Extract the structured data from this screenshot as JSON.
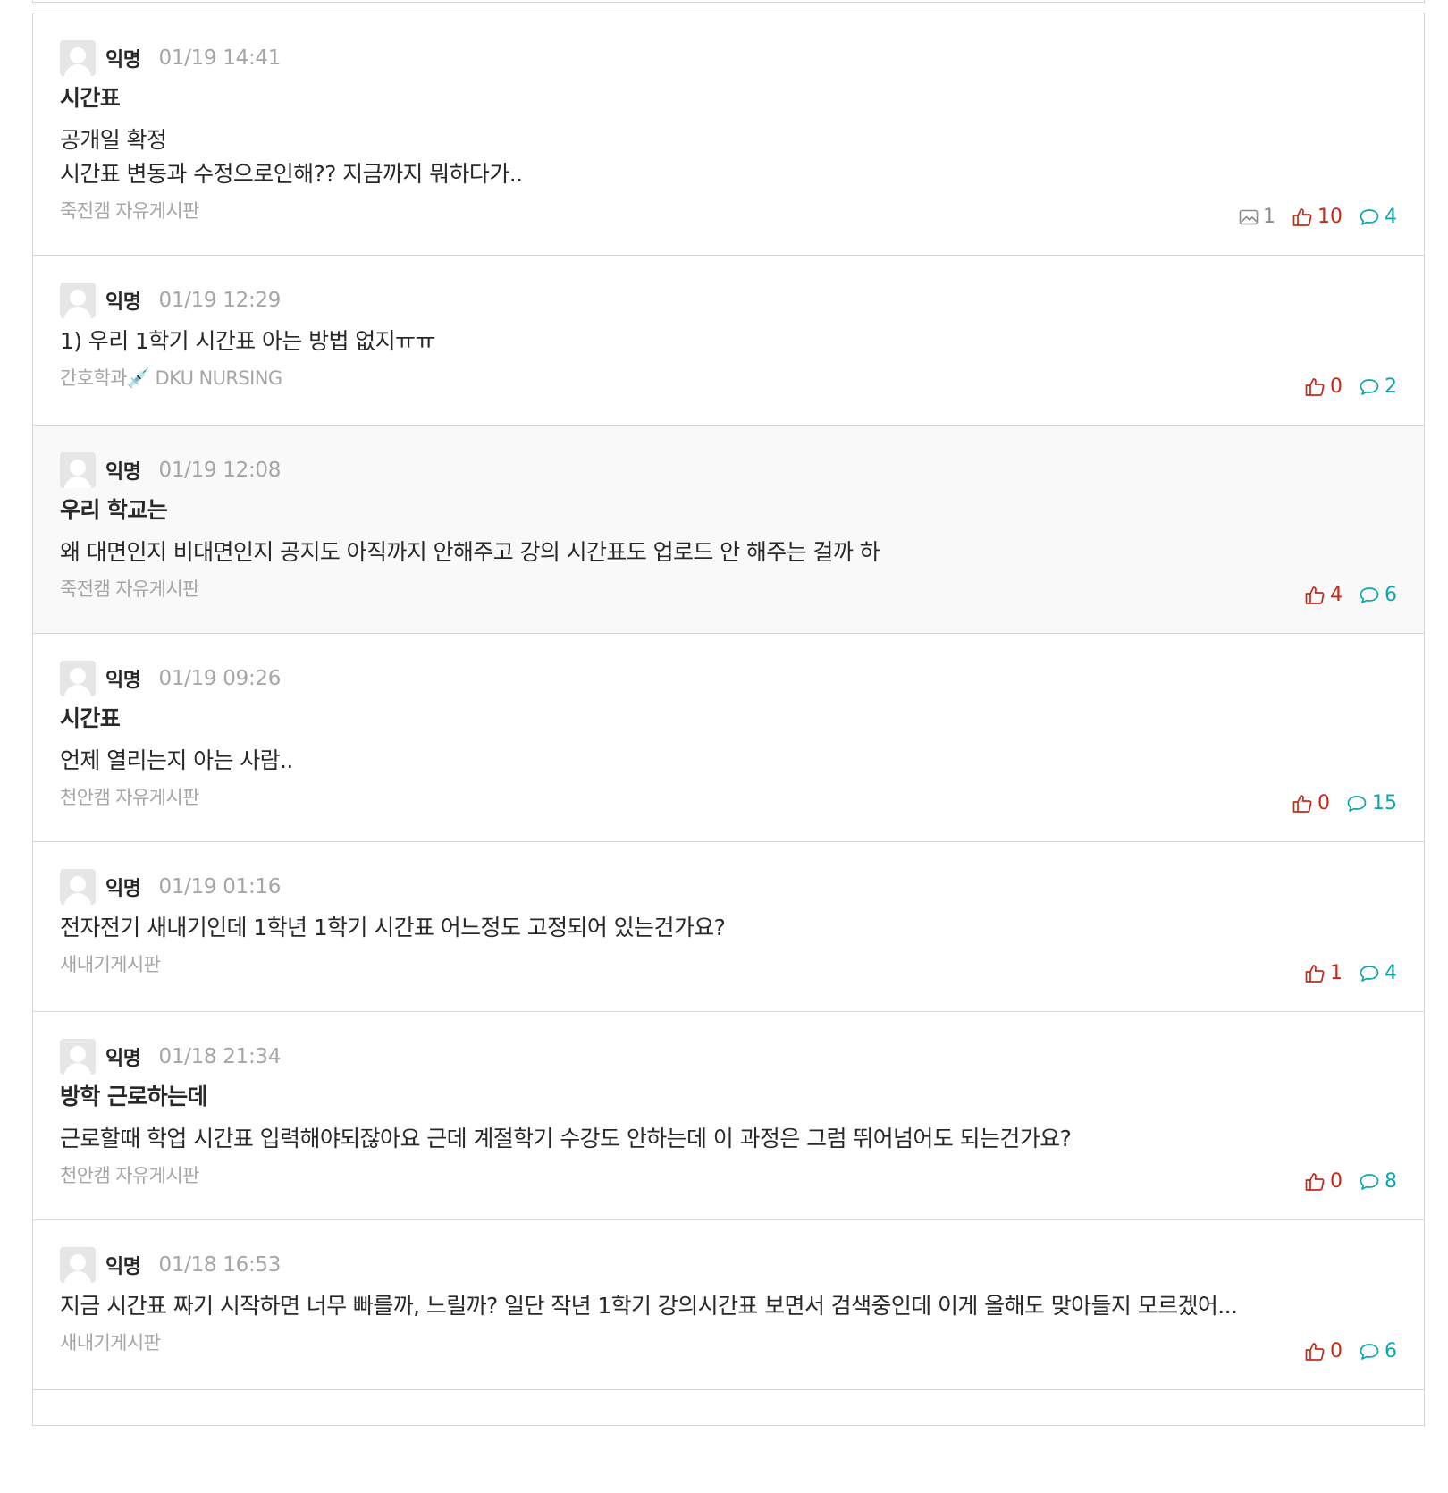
{
  "posts": [
    {
      "author": "익명",
      "time": "01/19 14:41",
      "title": "시간표",
      "body": [
        "공개일 확정",
        "시간표 변동과 수정으로인해?? 지금까지 뭐하다가.."
      ],
      "board": "죽전캠 자유게시판",
      "images": "1",
      "votes": "10",
      "comments": "4"
    },
    {
      "author": "익명",
      "time": "01/19 12:29",
      "title": "",
      "body": [
        "1) 우리 1학기 시간표 아는 방법 없지ㅠㅠ"
      ],
      "board": "간호학과💉 DKU NURSING",
      "images": "",
      "votes": "0",
      "comments": "2"
    },
    {
      "author": "익명",
      "time": "01/19 12:08",
      "title": "우리 학교는",
      "body": [
        "왜 대면인지 비대면인지 공지도 아직까지 안해주고 강의 시간표도 업로드 안 해주는 걸까 하"
      ],
      "board": "죽전캠 자유게시판",
      "images": "",
      "votes": "4",
      "comments": "6"
    },
    {
      "author": "익명",
      "time": "01/19 09:26",
      "title": "시간표",
      "body": [
        "언제 열리는지 아는 사람.."
      ],
      "board": "천안캠 자유게시판",
      "images": "",
      "votes": "0",
      "comments": "15"
    },
    {
      "author": "익명",
      "time": "01/19 01:16",
      "title": "",
      "body": [
        "전자전기 새내기인데 1학년 1학기 시간표 어느정도 고정되어 있는건가요?"
      ],
      "board": "새내기게시판",
      "images": "",
      "votes": "1",
      "comments": "4"
    },
    {
      "author": "익명",
      "time": "01/18 21:34",
      "title": "방학 근로하는데",
      "body": [
        "근로할때 학업 시간표 입력해야되잖아요 근데 계절학기 수강도 안하는데 이 과정은 그럼 뛰어넘어도 되는건가요?"
      ],
      "board": "천안캠 자유게시판",
      "images": "",
      "votes": "0",
      "comments": "8"
    },
    {
      "author": "익명",
      "time": "01/18 16:53",
      "title": "",
      "body": [
        "지금 시간표 짜기 시작하면 너무 빠를까, 느릴까? 일단 작년 1학기 강의시간표 보면서 검색중인데 이게 올해도 맞아들지 모르겠어..."
      ],
      "board": "새내기게시판",
      "images": "",
      "votes": "0",
      "comments": "6"
    }
  ]
}
